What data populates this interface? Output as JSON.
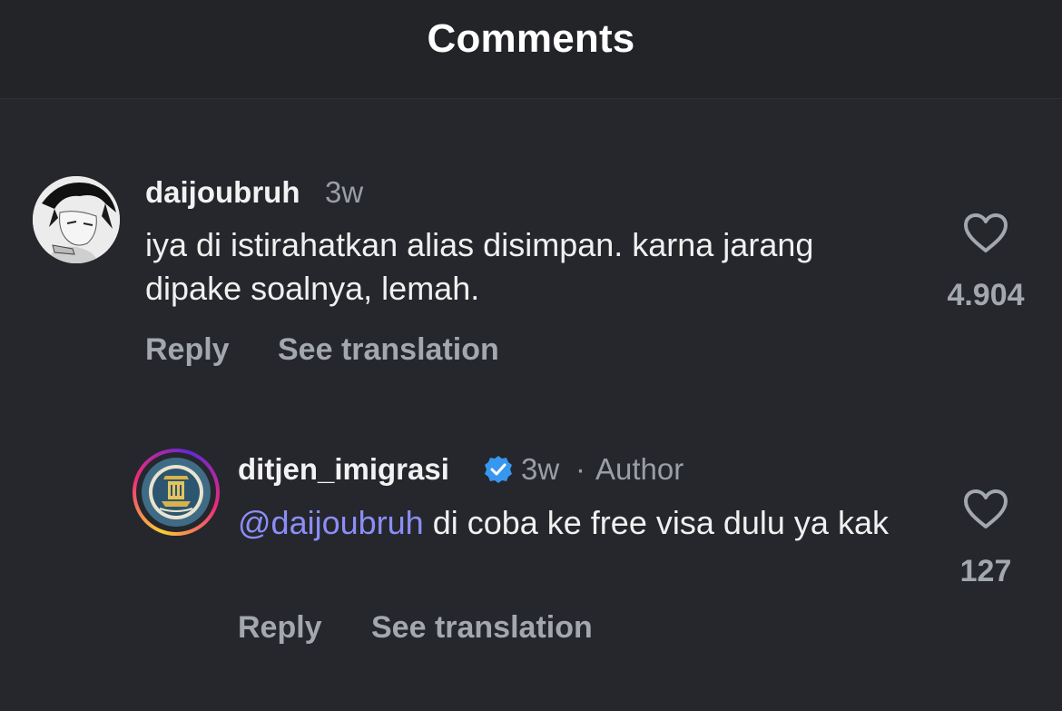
{
  "header": {
    "title": "Comments"
  },
  "comments": [
    {
      "username": "daijoubruh",
      "time": "3w",
      "text": "iya di istirahatkan alias disimpan. karna jarang dipake soalnya, lemah.",
      "likes": "4.904",
      "reply_label": "Reply",
      "translate_label": "See translation",
      "avatar_icon": "manga-portrait-avatar"
    },
    {
      "username": "ditjen_imigrasi",
      "verified": true,
      "time": "3w",
      "separator": "·",
      "author_label": "Author",
      "mention": "@daijoubruh",
      "text": " di coba ke free visa dulu ya kak",
      "likes": "127",
      "reply_label": "Reply",
      "translate_label": "See translation",
      "avatar_icon": "immigration-emblem-avatar",
      "story_ring_colors": [
        "#f9ce34",
        "#ee2a7b",
        "#6228d7"
      ]
    }
  ],
  "colors": {
    "background": "#25272c",
    "mention": "#8b8ef7",
    "verified": "#3797f0",
    "muted": "#a3a7ae"
  }
}
